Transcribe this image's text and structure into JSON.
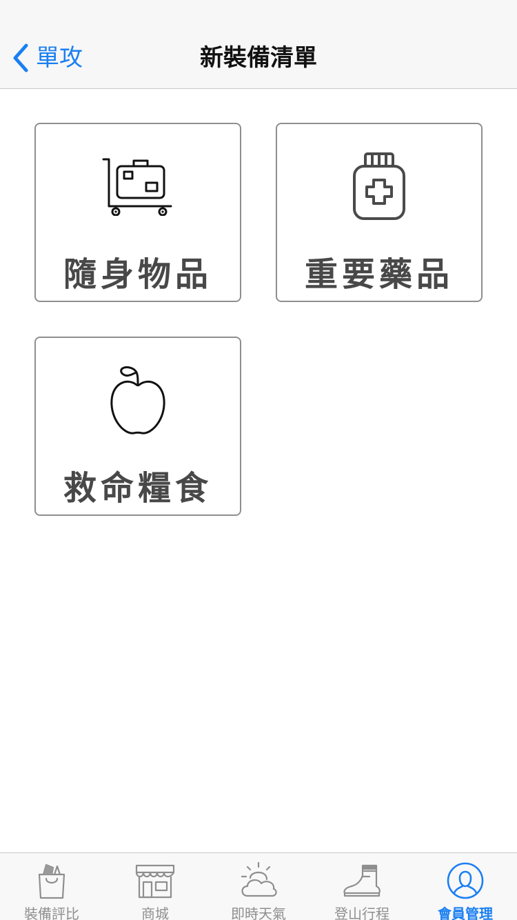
{
  "nav": {
    "back_label": "單攻",
    "title": "新裝備清單"
  },
  "cards": [
    {
      "label": "隨身物品",
      "icon": "luggage-cart-icon"
    },
    {
      "label": "重要藥品",
      "icon": "medicine-bottle-icon"
    },
    {
      "label": "救命糧食",
      "icon": "apple-icon"
    }
  ],
  "tabs": [
    {
      "label": "裝備評比",
      "icon": "shopping-bag-icon"
    },
    {
      "label": "商城",
      "icon": "storefront-icon"
    },
    {
      "label": "即時天氣",
      "icon": "weather-icon"
    },
    {
      "label": "登山行程",
      "icon": "hiking-boot-icon"
    },
    {
      "label": "會員管理",
      "icon": "user-profile-icon",
      "active": true
    }
  ],
  "colors": {
    "accent": "#1a7ff2",
    "tab_inactive": "#8e8e8e",
    "card_border": "#8e8e8e",
    "card_text": "#484848"
  }
}
